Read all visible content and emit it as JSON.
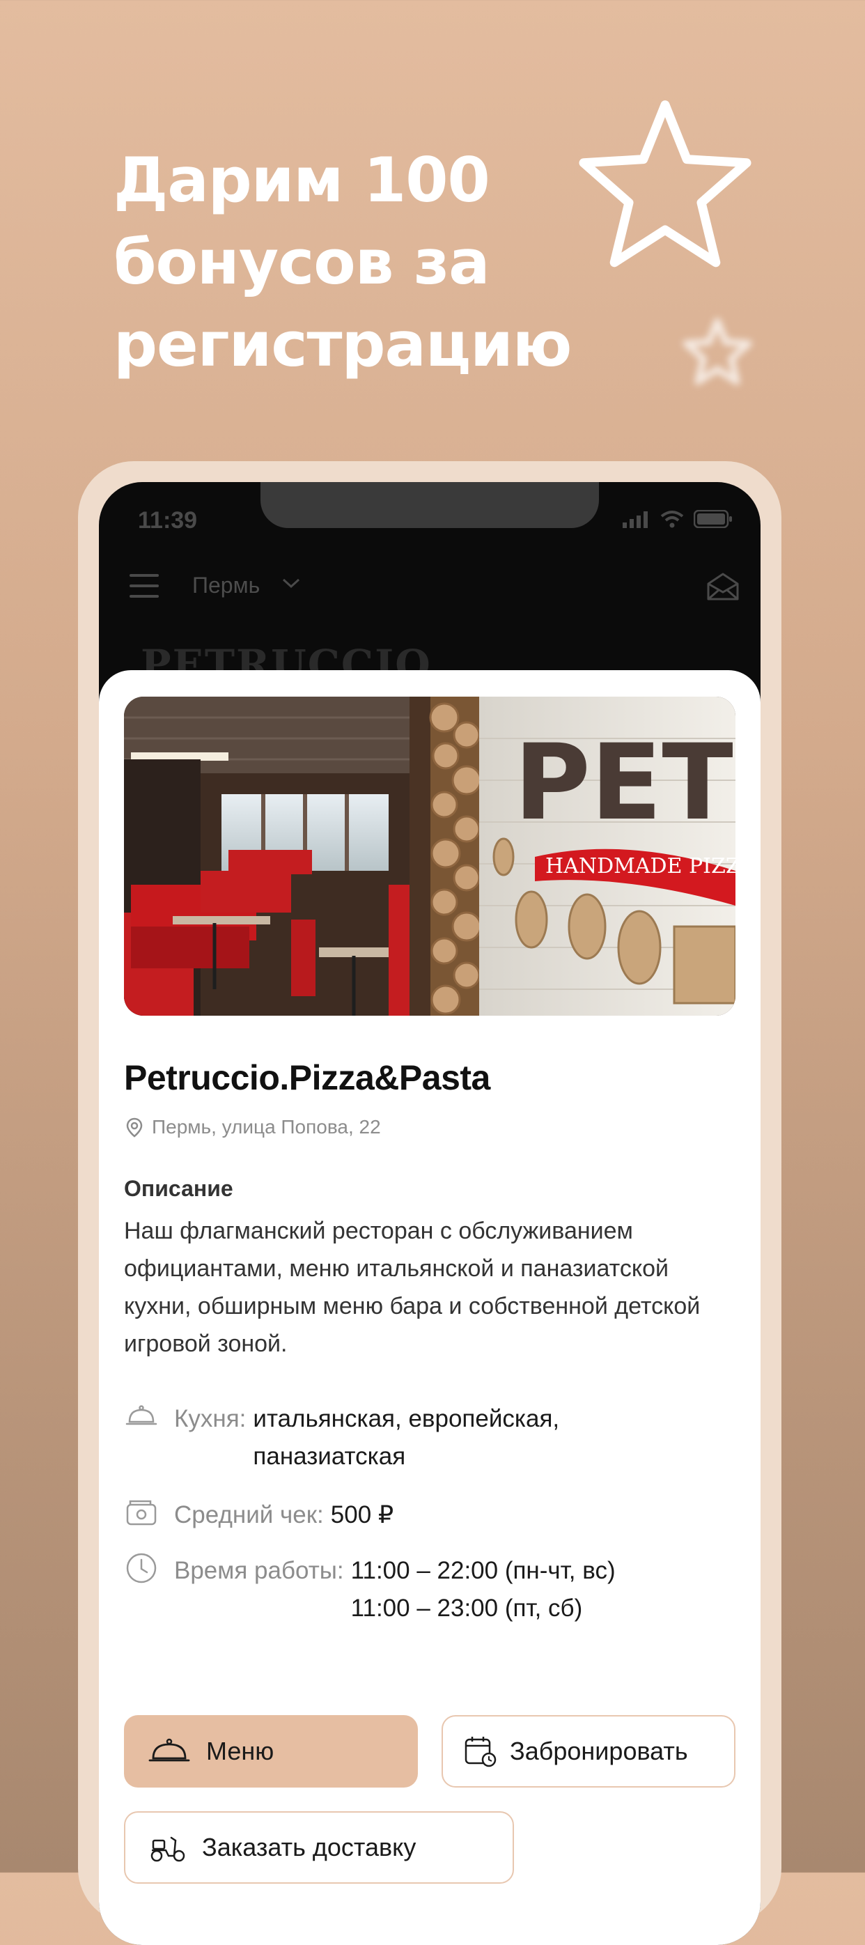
{
  "promo": {
    "title_lines": [
      "Дарим 100",
      "бонусов за",
      "регистрацию"
    ]
  },
  "status_bar": {
    "time": "11:39"
  },
  "header": {
    "city": "Пермь",
    "behind_logo": "PETRUCCIO"
  },
  "restaurant": {
    "name": "Petruccio.Pizza&Pasta",
    "address": "Пермь, улица Попова, 22",
    "description_title": "Описание",
    "description": "Наш флагманский ресторан с обслуживанием официантами, меню итальянской и паназиатской кухни, обширным меню бара и собственной детской игровой зоной.",
    "hero_sign": {
      "name": "PETRU",
      "tagline": "HANDMADE PIZZA"
    },
    "cuisine_label": "Кухня:",
    "cuisine_value": "итальянская, европейская, паназиатская",
    "avg_check_label": "Средний чек:",
    "avg_check_value": "500 ₽",
    "hours_label": "Время работы:",
    "hours_line1": "11:00 – 22:00 (пн-чт, вс)",
    "hours_line2": "11:00 – 23:00 (пт, сб)"
  },
  "buttons": {
    "menu": "Меню",
    "book": "Забронировать",
    "delivery": "Заказать доставку"
  },
  "colors": {
    "accent": "#e6bea2",
    "accent_border": "#e8c7b0",
    "background_top": "#e3bc9f",
    "background_bottom": "#a8886f"
  },
  "icons": [
    "star-icon",
    "menu-icon",
    "chevron-down-icon",
    "mail-icon",
    "location-pin-icon",
    "cloche-icon",
    "wallet-icon",
    "clock-icon",
    "calendar-icon",
    "scooter-icon"
  ]
}
